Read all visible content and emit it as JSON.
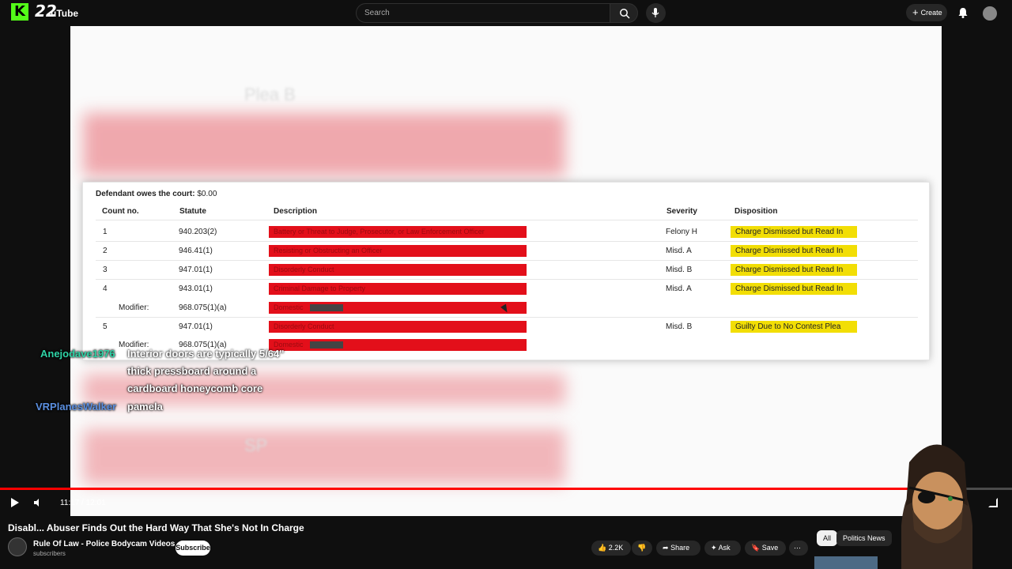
{
  "topbar": {
    "logo_letter": "K",
    "logo_number": "22",
    "logo_text": "uTube",
    "search_placeholder": "Search",
    "create_label": "Create"
  },
  "video": {
    "blur_text_1": "Plea B",
    "blur_text_2": "SP",
    "court": {
      "owes_label": "Defendant owes the court:",
      "owes_value": "$0.00",
      "headers": [
        "Count no.",
        "Statute",
        "Description",
        "Severity",
        "Disposition"
      ],
      "rows": [
        {
          "count": "1",
          "statute": "940.203(2)",
          "description": "Battery or Threat to Judge, Prosecutor, or Law Enforcement Officer",
          "severity": "Felony H",
          "disposition": "Charge Dismissed but Read In"
        },
        {
          "count": "2",
          "statute": "946.41(1)",
          "description": "Resisting or Obstructing an Officer",
          "severity": "Misd. A",
          "disposition": "Charge Dismissed but Read In"
        },
        {
          "count": "3",
          "statute": "947.01(1)",
          "description": "Disorderly Conduct",
          "severity": "Misd. B",
          "disposition": "Charge Dismissed but Read In"
        },
        {
          "count": "4",
          "statute": "943.01(1)",
          "description": "Criminal Damage to Property",
          "severity": "Misd. A",
          "disposition": "Charge Dismissed but Read In"
        },
        {
          "modifier_label": "Modifier:",
          "statute": "968.075(1)(a)",
          "description": "Domestic"
        },
        {
          "count": "5",
          "statute": "947.01(1)",
          "description": "Disorderly Conduct",
          "severity": "Misd. B",
          "disposition": "Guilty Due to No Contest Plea"
        },
        {
          "modifier_label": "Modifier:",
          "statute": "968.075(1)(a)",
          "description": "Domestic"
        }
      ]
    }
  },
  "chat": [
    {
      "user": "Anejodave1976",
      "user_color": "#2fd4a7",
      "message": "Interior doors are typically 5/64\""
    },
    {
      "user": "",
      "user_color": "#ffffff",
      "message": "thick pressboard around a"
    },
    {
      "user": "",
      "user_color": "#ffffff",
      "message": "cardboard honeycomb core"
    },
    {
      "user": "VRPlanesWalker",
      "user_color": "#5b8fe0",
      "message": "pamela"
    }
  ],
  "player": {
    "time": "11:17 / 12:01",
    "progress_fraction": 0.937
  },
  "info": {
    "title": "Disabl... Abuser Finds Out the Hard Way That She's Not In Charge",
    "channel_name": "Rule Of Law - Police Bodycam Videos",
    "channel_subs": "subscribers",
    "subscribe_label": "Subscribe",
    "like_count": "2.2K",
    "share_label": "Share",
    "ask_label": "Ask",
    "save_label": "Save",
    "more_label": "⋯",
    "chip_all": "All",
    "chip_politics": "Politics News"
  },
  "colors": {
    "accent": "#ff0000",
    "redacted": "#e30f1a",
    "disposition": "#f2de05",
    "kick_green": "#53fc18"
  }
}
